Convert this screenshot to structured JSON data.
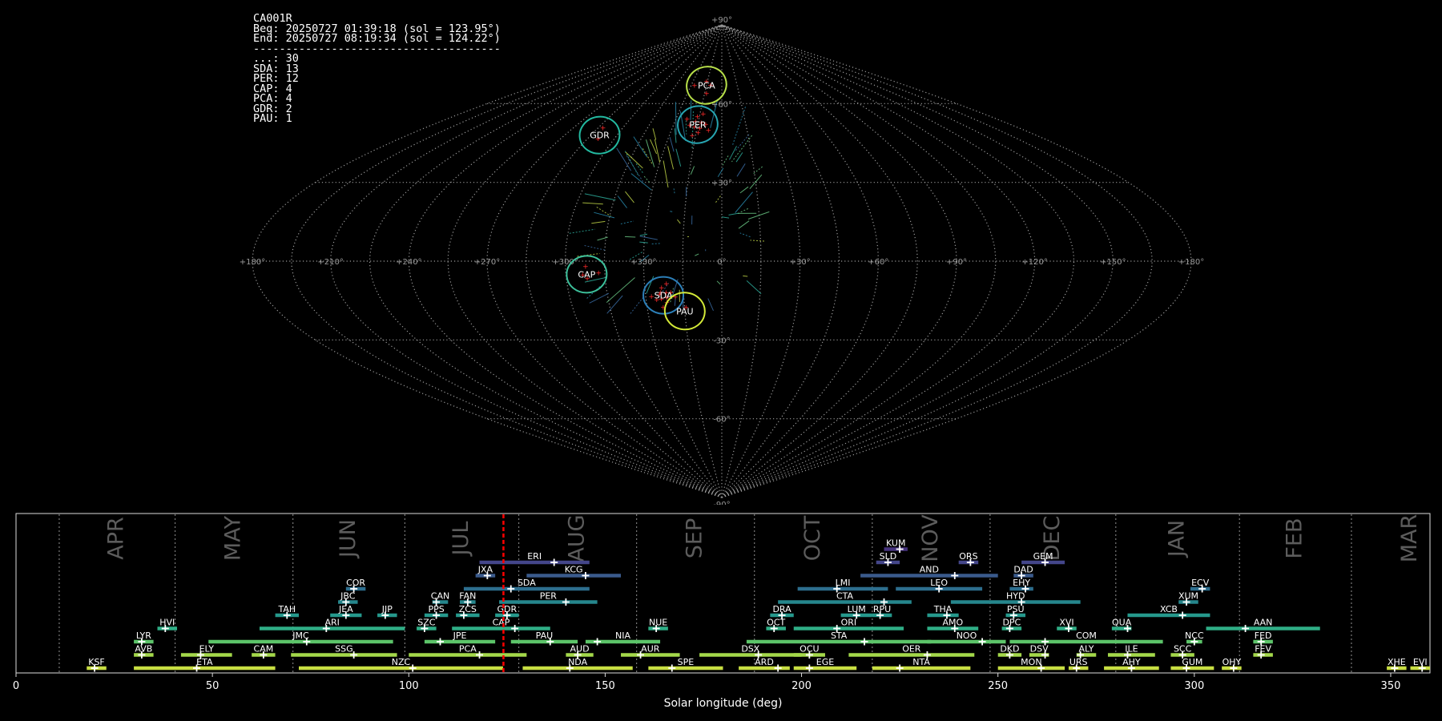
{
  "info": {
    "station": "CA001R",
    "beg": "Beg: 20250727 01:39:18 (sol = 123.95°)",
    "end": "End: 20250727 08:19:34 (sol = 124.22°)",
    "separator": "--------------------------------------",
    "counts": [
      {
        "code": "...",
        "n": 30
      },
      {
        "code": "SDA",
        "n": 13
      },
      {
        "code": "PER",
        "n": 12
      },
      {
        "code": "CAP",
        "n": 4
      },
      {
        "code": "PCA",
        "n": 4
      },
      {
        "code": "GDR",
        "n": 2
      },
      {
        "code": "PAU",
        "n": 1
      }
    ]
  },
  "colors": {
    "background": "#000000",
    "grid": "#9a9a9a",
    "marker": "#ff2a2a",
    "current_sol_line": "#ff0000"
  },
  "chart_data": [
    {
      "type": "scatter",
      "projection": "sinusoidal",
      "x_ticks": [
        "+180°",
        "+150°",
        "+120°",
        "+90°",
        "+60°",
        "+30°",
        "0°",
        "+330°",
        "+300°",
        "+270°",
        "+240°",
        "+210°",
        "+180°"
      ],
      "y_ticks": [
        "+90°",
        "+60°",
        "+30°",
        "-30°",
        "-60°",
        "-90°"
      ],
      "showers": [
        {
          "code": "PCA",
          "lon": -15,
          "lat": 67,
          "color": "#b8e04a"
        },
        {
          "code": "PER",
          "lon": -15,
          "lat": 52,
          "color": "#27a4b0"
        },
        {
          "code": "GDR",
          "lon": -70,
          "lat": 48,
          "color": "#23b9a0"
        },
        {
          "code": "CAP",
          "lon": -52,
          "lat": -5,
          "color": "#3cbf9a"
        },
        {
          "code": "SDA",
          "lon": -23,
          "lat": -13,
          "color": "#2c7fb8"
        },
        {
          "code": "PAU",
          "lon": -15,
          "lat": -19,
          "color": "#d4ea38"
        }
      ]
    },
    {
      "type": "bar",
      "orientation": "horizontal",
      "xlabel": "Solar longitude (deg)",
      "xlim": [
        0,
        360
      ],
      "x_ticks": [
        0,
        50,
        100,
        150,
        200,
        250,
        300,
        350
      ],
      "current_sol": 124.1,
      "months": [
        {
          "name": "APR",
          "start": 11
        },
        {
          "name": "MAY",
          "start": 40.5
        },
        {
          "name": "JUN",
          "start": 70.5
        },
        {
          "name": "JUL",
          "start": 99
        },
        {
          "name": "AUG",
          "start": 128
        },
        {
          "name": "SEP",
          "start": 158
        },
        {
          "name": "OCT",
          "start": 188
        },
        {
          "name": "NOV",
          "start": 218
        },
        {
          "name": "DEC",
          "start": 248
        },
        {
          "name": "JAN",
          "start": 280
        },
        {
          "name": "FEB",
          "start": 311.5
        },
        {
          "name": "MAR",
          "start": 340
        }
      ],
      "showers": [
        {
          "code": "KUM",
          "start": 221,
          "end": 227,
          "peak": 225,
          "row": 10
        },
        {
          "code": "ERI",
          "start": 118,
          "end": 146,
          "peak": 137,
          "row": 9
        },
        {
          "code": "SLD",
          "start": 219,
          "end": 225,
          "peak": 222,
          "row": 9
        },
        {
          "code": "ORS",
          "start": 240,
          "end": 245,
          "peak": 243,
          "row": 9
        },
        {
          "code": "GEM",
          "start": 256,
          "end": 267,
          "peak": 262,
          "row": 9
        },
        {
          "code": "JXA",
          "start": 117,
          "end": 122,
          "peak": 120,
          "row": 8
        },
        {
          "code": "KCG",
          "start": 130,
          "end": 154,
          "peak": 145,
          "row": 8
        },
        {
          "code": "AND",
          "start": 215,
          "end": 250,
          "peak": 239,
          "row": 8
        },
        {
          "code": "DAD",
          "start": 254,
          "end": 259,
          "peak": 256,
          "row": 8
        },
        {
          "code": "COR",
          "start": 84,
          "end": 89,
          "peak": 86,
          "row": 7
        },
        {
          "code": "SDA",
          "start": 114,
          "end": 146,
          "peak": 126,
          "row": 7
        },
        {
          "code": "LMI",
          "start": 199,
          "end": 222,
          "peak": 209,
          "row": 7
        },
        {
          "code": "LEO",
          "start": 224,
          "end": 246,
          "peak": 235,
          "row": 7
        },
        {
          "code": "EHY",
          "start": 253,
          "end": 259,
          "peak": 257,
          "row": 7
        },
        {
          "code": "ECV",
          "start": 299,
          "end": 304,
          "peak": 302,
          "row": 7
        },
        {
          "code": "JBC",
          "start": 82,
          "end": 87,
          "peak": 84,
          "row": 6
        },
        {
          "code": "CAN",
          "start": 106,
          "end": 110,
          "peak": 107,
          "row": 6
        },
        {
          "code": "FAN",
          "start": 113,
          "end": 117,
          "peak": 115,
          "row": 6
        },
        {
          "code": "PER",
          "start": 123,
          "end": 148,
          "peak": 140,
          "row": 6
        },
        {
          "code": "CTA",
          "start": 194,
          "end": 228,
          "peak": 221,
          "row": 6
        },
        {
          "code": "HYD",
          "start": 238,
          "end": 271,
          "peak": 256,
          "row": 6
        },
        {
          "code": "XUM",
          "start": 296,
          "end": 301,
          "peak": 298,
          "row": 6
        },
        {
          "code": "TAH",
          "start": 66,
          "end": 72,
          "peak": 69,
          "row": 5
        },
        {
          "code": "JEA",
          "start": 80,
          "end": 88,
          "peak": 84,
          "row": 5
        },
        {
          "code": "JIP",
          "start": 92,
          "end": 97,
          "peak": 94,
          "row": 5
        },
        {
          "code": "PPS",
          "start": 104,
          "end": 110,
          "peak": 107,
          "row": 5
        },
        {
          "code": "ZCS",
          "start": 112,
          "end": 118,
          "peak": 114,
          "row": 5
        },
        {
          "code": "GDR",
          "start": 122,
          "end": 128,
          "peak": 125,
          "row": 5
        },
        {
          "code": "DRA",
          "start": 192,
          "end": 198,
          "peak": 195,
          "row": 5
        },
        {
          "code": "LUM",
          "start": 210,
          "end": 218,
          "peak": 214,
          "row": 5
        },
        {
          "code": "RPU",
          "start": 218,
          "end": 223,
          "peak": 220,
          "row": 5
        },
        {
          "code": "THA",
          "start": 232,
          "end": 240,
          "peak": 237,
          "row": 5
        },
        {
          "code": "PSU",
          "start": 252,
          "end": 257,
          "peak": 254,
          "row": 5
        },
        {
          "code": "XCB",
          "start": 283,
          "end": 304,
          "peak": 297,
          "row": 5
        },
        {
          "code": "HVI",
          "start": 36,
          "end": 41,
          "peak": 38,
          "row": 4
        },
        {
          "code": "ARI",
          "start": 62,
          "end": 99,
          "peak": 79,
          "row": 4
        },
        {
          "code": "SZC",
          "start": 102,
          "end": 107,
          "peak": 104,
          "row": 4
        },
        {
          "code": "CAP",
          "start": 111,
          "end": 136,
          "peak": 127,
          "row": 4
        },
        {
          "code": "NUE",
          "start": 161,
          "end": 166,
          "peak": 163,
          "row": 4
        },
        {
          "code": "OCT",
          "start": 191,
          "end": 196,
          "peak": 193,
          "row": 4
        },
        {
          "code": "ORI",
          "start": 198,
          "end": 226,
          "peak": 209,
          "row": 4
        },
        {
          "code": "AMO",
          "start": 232,
          "end": 245,
          "peak": 239,
          "row": 4
        },
        {
          "code": "DPC",
          "start": 251,
          "end": 256,
          "peak": 253,
          "row": 4
        },
        {
          "code": "XVI",
          "start": 265,
          "end": 270,
          "peak": 268,
          "row": 4
        },
        {
          "code": "QUA",
          "start": 279,
          "end": 284,
          "peak": 283,
          "row": 4
        },
        {
          "code": "AAN",
          "start": 303,
          "end": 332,
          "peak": 313,
          "row": 4
        },
        {
          "code": "LYR",
          "start": 30,
          "end": 35,
          "peak": 32,
          "row": 3
        },
        {
          "code": "JMC",
          "start": 49,
          "end": 96,
          "peak": 74,
          "row": 3
        },
        {
          "code": "JPE",
          "start": 104,
          "end": 122,
          "peak": 108,
          "row": 3
        },
        {
          "code": "PAU",
          "start": 126,
          "end": 143,
          "peak": 136,
          "row": 3
        },
        {
          "code": "NIA",
          "start": 145,
          "end": 164,
          "peak": 148,
          "row": 3
        },
        {
          "code": "STA",
          "start": 186,
          "end": 233,
          "peak": 216,
          "row": 3
        },
        {
          "code": "NOO",
          "start": 232,
          "end": 252,
          "peak": 246,
          "row": 3
        },
        {
          "code": "COM",
          "start": 253,
          "end": 292,
          "peak": 262,
          "row": 3
        },
        {
          "code": "NCC",
          "start": 298,
          "end": 302,
          "peak": 300,
          "row": 3
        },
        {
          "code": "FED",
          "start": 315,
          "end": 320,
          "peak": 317,
          "row": 3
        },
        {
          "code": "AVB",
          "start": 30,
          "end": 35,
          "peak": 32,
          "row": 2
        },
        {
          "code": "ELY",
          "start": 42,
          "end": 55,
          "peak": 47,
          "row": 2
        },
        {
          "code": "CAM",
          "start": 60,
          "end": 66,
          "peak": 63,
          "row": 2
        },
        {
          "code": "SSG",
          "start": 70,
          "end": 97,
          "peak": 86,
          "row": 2
        },
        {
          "code": "PCA",
          "start": 100,
          "end": 130,
          "peak": 118,
          "row": 2
        },
        {
          "code": "AUD",
          "start": 140,
          "end": 147,
          "peak": 143,
          "row": 2
        },
        {
          "code": "AUR",
          "start": 154,
          "end": 169,
          "peak": 159,
          "row": 2
        },
        {
          "code": "DSX",
          "start": 174,
          "end": 200,
          "peak": 189,
          "row": 2
        },
        {
          "code": "OCU",
          "start": 198,
          "end": 206,
          "peak": 202,
          "row": 2
        },
        {
          "code": "OER",
          "start": 212,
          "end": 244,
          "peak": 232,
          "row": 2
        },
        {
          "code": "DKD",
          "start": 250,
          "end": 256,
          "peak": 253,
          "row": 2
        },
        {
          "code": "DSV",
          "start": 258,
          "end": 263,
          "peak": 262,
          "row": 2
        },
        {
          "code": "ALY",
          "start": 270,
          "end": 275,
          "peak": 271,
          "row": 2
        },
        {
          "code": "ILE",
          "start": 278,
          "end": 290,
          "peak": 283,
          "row": 2
        },
        {
          "code": "SCC",
          "start": 294,
          "end": 300,
          "peak": 297,
          "row": 2
        },
        {
          "code": "FEV",
          "start": 315,
          "end": 320,
          "peak": 317,
          "row": 2
        },
        {
          "code": "KSF",
          "start": 18,
          "end": 23,
          "peak": 20,
          "row": 1
        },
        {
          "code": "ETA",
          "start": 30,
          "end": 66,
          "peak": 46,
          "row": 1
        },
        {
          "code": "NZC",
          "start": 72,
          "end": 124,
          "peak": 101,
          "row": 1
        },
        {
          "code": "NDA",
          "start": 129,
          "end": 157,
          "peak": 141,
          "row": 1
        },
        {
          "code": "SPE",
          "start": 161,
          "end": 180,
          "peak": 167,
          "row": 1
        },
        {
          "code": "ARD",
          "start": 184,
          "end": 197,
          "peak": 194,
          "row": 1
        },
        {
          "code": "EGE",
          "start": 198,
          "end": 214,
          "peak": 202,
          "row": 1
        },
        {
          "code": "NTA",
          "start": 218,
          "end": 243,
          "peak": 225,
          "row": 1
        },
        {
          "code": "MON",
          "start": 250,
          "end": 267,
          "peak": 261,
          "row": 1
        },
        {
          "code": "URS",
          "start": 268,
          "end": 273,
          "peak": 270,
          "row": 1
        },
        {
          "code": "AHY",
          "start": 277,
          "end": 291,
          "peak": 284,
          "row": 1
        },
        {
          "code": "GUM",
          "start": 294,
          "end": 305,
          "peak": 298,
          "row": 1
        },
        {
          "code": "OHY",
          "start": 307,
          "end": 312,
          "peak": 310,
          "row": 1
        },
        {
          "code": "XHE",
          "start": 349,
          "end": 354,
          "peak": 351,
          "row": 1
        },
        {
          "code": "EVI",
          "start": 355,
          "end": 360,
          "peak": 358,
          "row": 1
        }
      ]
    }
  ]
}
